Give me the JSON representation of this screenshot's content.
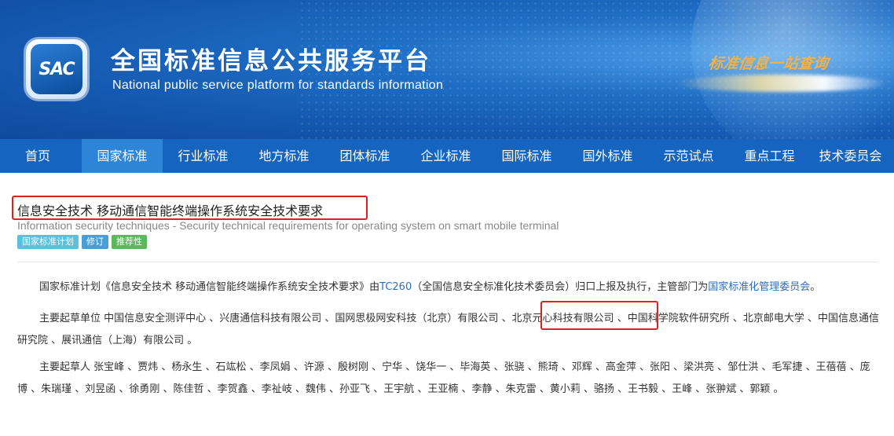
{
  "header": {
    "logo_text": "SAC",
    "title_cn": "全国标准信息公共服务平台",
    "title_en": "National public service platform  for standards information",
    "slogan": "标准信息一站查询"
  },
  "nav": {
    "items": [
      {
        "label": "首页"
      },
      {
        "label": "国家标准"
      },
      {
        "label": "行业标准"
      },
      {
        "label": "地方标准"
      },
      {
        "label": "团体标准"
      },
      {
        "label": "企业标准"
      },
      {
        "label": "国际标准"
      },
      {
        "label": "国外标准"
      },
      {
        "label": "示范试点"
      },
      {
        "label": "重点工程"
      },
      {
        "label": "技术委员会"
      }
    ],
    "active": "国家标准"
  },
  "document": {
    "title": "信息安全技术 移动通信智能终端操作系统安全技术要求",
    "title_en": "Information security techniques - Security technical requirements for operating system on smart mobile terminal",
    "badges": [
      {
        "label": "国家标准计划",
        "color": "#5bc0de"
      },
      {
        "label": "修订",
        "color": "#4a9ed8"
      },
      {
        "label": "推荐性",
        "color": "#5cb85c"
      }
    ],
    "plan": {
      "prefix": "国家标准计划《信息安全技术 移动通信智能终端操作系统安全技术要求》由",
      "tc_link": "TC260",
      "middle": "（全国信息安全标准化技术委员会）归口上报及执行，主管部门为",
      "dept_link": "国家标准化管理委员会",
      "suffix": "。"
    },
    "drafting_units": {
      "label": "主要起草单位",
      "before": " 中国信息安全测评中心 、兴唐通信科技有限公司 、国网思极网安科技（北京）有限公司 、",
      "highlighted": "北京元心科技有限公司",
      "after": " 、中国科学院软件研究所 、北京邮电大学 、中国信息通信研究院 、展讯通信（上海）有限公司 。"
    },
    "drafters": {
      "label": "主要起草人",
      "text": " 张宝峰 、贾炜 、杨永生 、石竑松 、李凤娟 、许源 、殷树刚 、宁华 、饶华一 、毕海英 、张骁 、熊琦 、邓辉 、高金萍 、张阳 、梁洪亮 、邹仕洪 、毛军捷 、王蓓蓓 、庞博 、朱瑞瑾 、刘昱函 、徐勇刚 、陈佳哲 、李贺鑫 、李祉岐 、魏伟 、孙亚飞 、王宇航 、王亚楠 、李静 、朱克雷 、黄小莉 、骆扬 、王书毅 、王峰 、张翀斌 、郭颖 。"
    }
  }
}
